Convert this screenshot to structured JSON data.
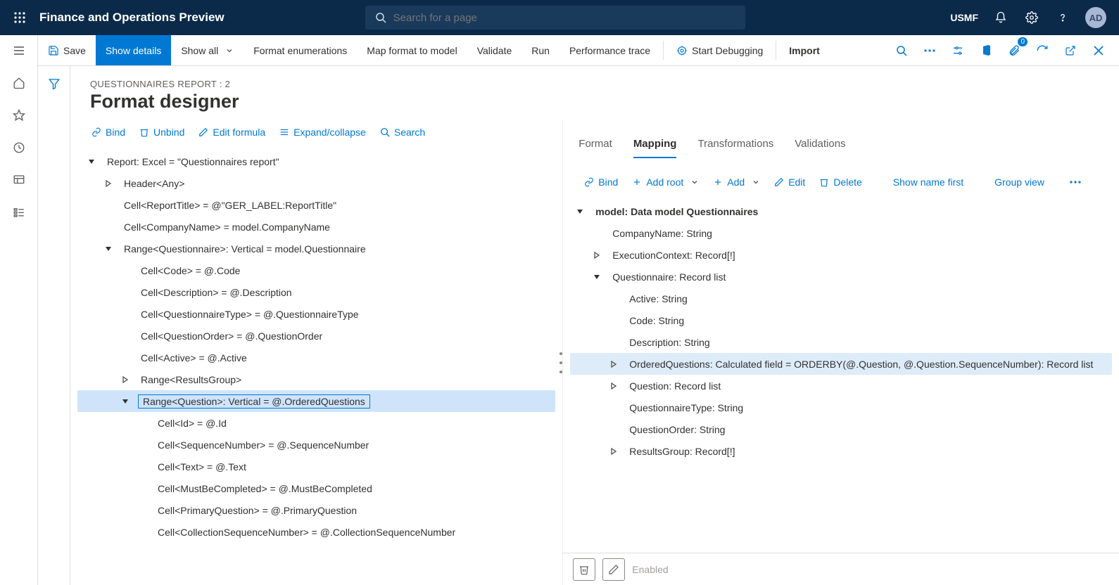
{
  "topbar": {
    "app_title": "Finance and Operations Preview",
    "search_placeholder": "Search for a page",
    "company": "USMF",
    "avatar": "AD"
  },
  "actionbar": {
    "save": "Save",
    "show_details": "Show details",
    "show_all": "Show all",
    "format_enum": "Format enumerations",
    "map_format": "Map format to model",
    "validate": "Validate",
    "run": "Run",
    "perf_trace": "Performance trace",
    "start_debug": "Start Debugging",
    "import": "Import",
    "attach_count": "0"
  },
  "page": {
    "breadcrumb": "QUESTIONNAIRES REPORT : 2",
    "title": "Format designer"
  },
  "left_toolbar": {
    "bind": "Bind",
    "unbind": "Unbind",
    "edit_formula": "Edit formula",
    "expand_collapse": "Expand/collapse",
    "search": "Search"
  },
  "left_tree": [
    {
      "depth": 0,
      "arrow": "down",
      "text": "Report: Excel = \"Questionnaires report\""
    },
    {
      "depth": 1,
      "arrow": "right",
      "text": "Header<Any>"
    },
    {
      "depth": 1,
      "arrow": "none",
      "text": "Cell<ReportTitle> = @\"GER_LABEL:ReportTitle\""
    },
    {
      "depth": 1,
      "arrow": "none",
      "text": "Cell<CompanyName> = model.CompanyName"
    },
    {
      "depth": 1,
      "arrow": "down",
      "text": "Range<Questionnaire>: Vertical = model.Questionnaire"
    },
    {
      "depth": 2,
      "arrow": "none",
      "text": "Cell<Code> = @.Code"
    },
    {
      "depth": 2,
      "arrow": "none",
      "text": "Cell<Description> = @.Description"
    },
    {
      "depth": 2,
      "arrow": "none",
      "text": "Cell<QuestionnaireType> = @.QuestionnaireType"
    },
    {
      "depth": 2,
      "arrow": "none",
      "text": "Cell<QuestionOrder> = @.QuestionOrder"
    },
    {
      "depth": 2,
      "arrow": "none",
      "text": "Cell<Active> = @.Active"
    },
    {
      "depth": 2,
      "arrow": "right",
      "text": "Range<ResultsGroup>"
    },
    {
      "depth": 2,
      "arrow": "down",
      "text": "Range<Question>: Vertical = @.OrderedQuestions",
      "selected": true
    },
    {
      "depth": 3,
      "arrow": "none",
      "text": "Cell<Id> = @.Id"
    },
    {
      "depth": 3,
      "arrow": "none",
      "text": "Cell<SequenceNumber> = @.SequenceNumber"
    },
    {
      "depth": 3,
      "arrow": "none",
      "text": "Cell<Text> = @.Text"
    },
    {
      "depth": 3,
      "arrow": "none",
      "text": "Cell<MustBeCompleted> = @.MustBeCompleted"
    },
    {
      "depth": 3,
      "arrow": "none",
      "text": "Cell<PrimaryQuestion> = @.PrimaryQuestion"
    },
    {
      "depth": 3,
      "arrow": "none",
      "text": "Cell<CollectionSequenceNumber> = @.CollectionSequenceNumber"
    }
  ],
  "right_tabs": {
    "format": "Format",
    "mapping": "Mapping",
    "transformations": "Transformations",
    "validations": "Validations"
  },
  "right_toolbar": {
    "bind": "Bind",
    "add_root": "Add root",
    "add": "Add",
    "edit": "Edit",
    "delete": "Delete",
    "show_name_first": "Show name first",
    "group_view": "Group view"
  },
  "right_tree": [
    {
      "depth": 0,
      "arrow": "down",
      "text": "model: Data model Questionnaires",
      "bold": true
    },
    {
      "depth": 1,
      "arrow": "none",
      "text": "CompanyName: String"
    },
    {
      "depth": 1,
      "arrow": "right",
      "text": "ExecutionContext: Record[!]"
    },
    {
      "depth": 1,
      "arrow": "down",
      "text": "Questionnaire: Record list"
    },
    {
      "depth": 2,
      "arrow": "none",
      "text": "Active: String"
    },
    {
      "depth": 2,
      "arrow": "none",
      "text": "Code: String"
    },
    {
      "depth": 2,
      "arrow": "none",
      "text": "Description: String"
    },
    {
      "depth": 2,
      "arrow": "right",
      "text": "OrderedQuestions: Calculated field = ORDERBY(@.Question, @.Question.SequenceNumber): Record list",
      "highlighted": true
    },
    {
      "depth": 2,
      "arrow": "right",
      "text": "Question: Record list"
    },
    {
      "depth": 2,
      "arrow": "none",
      "text": "QuestionnaireType: String"
    },
    {
      "depth": 2,
      "arrow": "none",
      "text": "QuestionOrder: String"
    },
    {
      "depth": 2,
      "arrow": "right",
      "text": "ResultsGroup: Record[!]"
    }
  ],
  "bottom": {
    "enabled": "Enabled"
  }
}
